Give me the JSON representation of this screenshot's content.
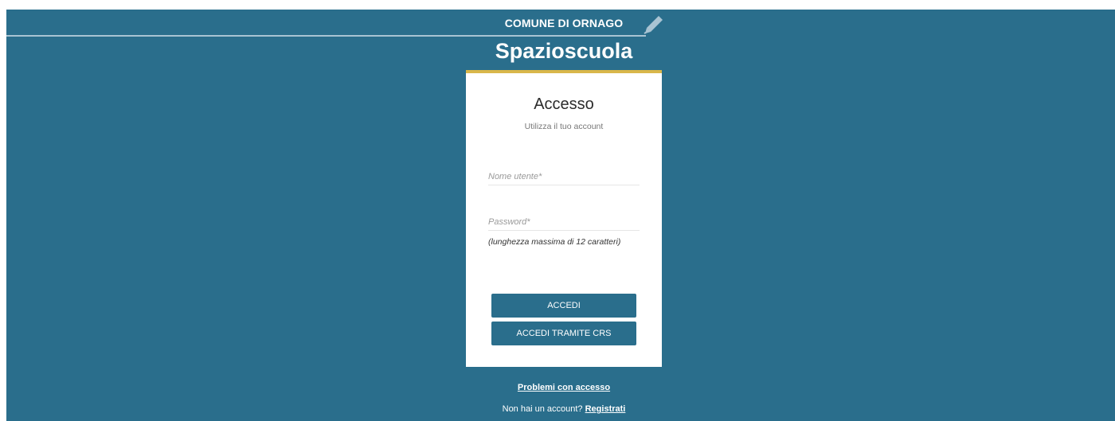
{
  "header": {
    "commune": "COMUNE DI ORNAGO",
    "app_title": "Spazioscuola",
    "edit_icon": "pencil-icon"
  },
  "login": {
    "title": "Accesso",
    "subtitle": "Utilizza il tuo account",
    "username_placeholder": "Nome utente*",
    "password_placeholder": "Password*",
    "password_hint": "(lunghezza massima di 12 caratteri)",
    "login_button": "ACCEDI",
    "crs_button": "ACCEDI TRAMITE CRS"
  },
  "footer": {
    "problems_link": "Problemi con accesso",
    "no_account_text": "Non hai un account?",
    "register_link": "Registrati"
  },
  "colors": {
    "background": "#2a6e8c",
    "accent": "#d9b74a",
    "card": "#ffffff"
  }
}
